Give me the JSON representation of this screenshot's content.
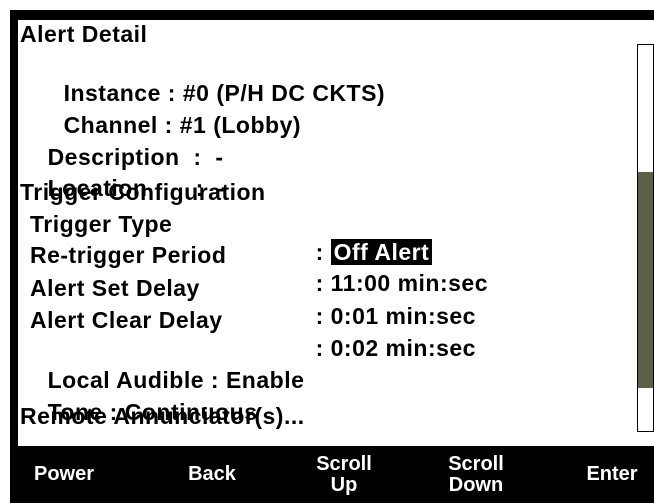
{
  "header": {
    "title": "Alert Detail"
  },
  "fields": [
    {
      "label": "Instance",
      "sep": " : ",
      "value": "#0 (P/H DC CKTS)"
    },
    {
      "label": "Channel",
      "sep": " : ",
      "value": "#1 (Lobby)"
    },
    {
      "label": "Description",
      "sep": "  :  ",
      "value": "-"
    },
    {
      "label": "Location",
      "sep": "       :  ",
      "value": "-"
    }
  ],
  "trigger": {
    "heading": "Trigger Configuration",
    "type_label": "Trigger Type",
    "type_value": "Off Alert",
    "retrigger_label": "Re-trigger Period",
    "retrigger_value": "11:00 min:sec",
    "set_delay_label": "Alert Set Delay",
    "set_delay_value": "0:01 min:sec",
    "clear_delay_label": "Alert Clear Delay",
    "clear_delay_value": "0:02 min:sec"
  },
  "local_audible": {
    "label": "Local Audible",
    "value": "Enable"
  },
  "tone": {
    "label": "Tone",
    "value": "Continuous"
  },
  "remote_annunciators": {
    "label": "Remote Annunciator(s)..."
  },
  "softkeys": [
    {
      "id": "power",
      "line1": "Power",
      "line2": ""
    },
    {
      "id": "back",
      "line1": "Back",
      "line2": ""
    },
    {
      "id": "scroll-up",
      "line1": "Scroll",
      "line2": "Up"
    },
    {
      "id": "scroll-down",
      "line1": "Scroll",
      "line2": "Down"
    },
    {
      "id": "enter",
      "line1": "Enter",
      "line2": ""
    }
  ],
  "scroll": {
    "position_fraction": 0.33,
    "visible_fraction": 0.56
  },
  "colors": {
    "frame": "#000000",
    "screen": "#ffffff",
    "selected_bg": "#000000",
    "scroll_thumb": "#5e5f48"
  }
}
